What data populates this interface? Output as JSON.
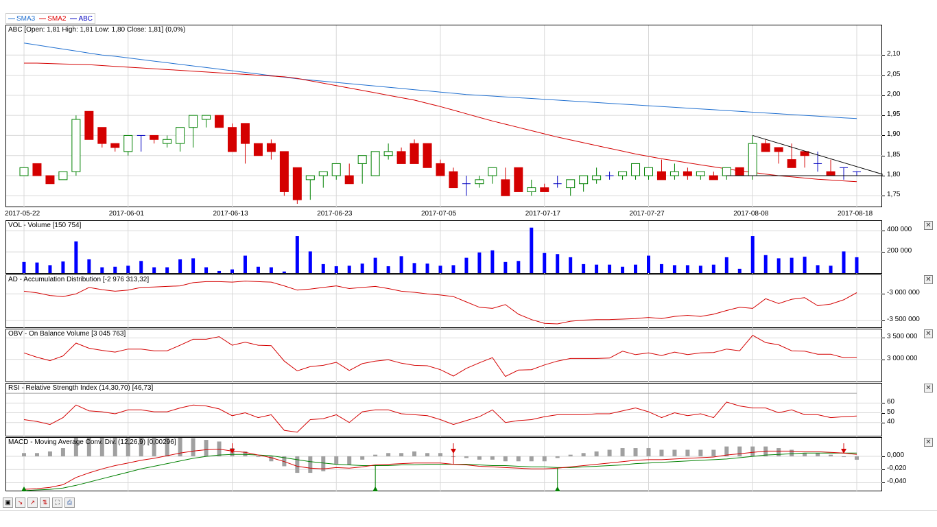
{
  "legend": [
    {
      "label": "SMA3",
      "color": "#1f6fd0"
    },
    {
      "label": "SMA2",
      "color": "#e00000"
    },
    {
      "label": "ABC",
      "color": "#0000c0"
    }
  ],
  "main": {
    "title": "ABC [Open: 1,81  High: 1,81  Low: 1,80  Close: 1,81] (0,0%)",
    "y_ticks": [
      "2,10",
      "2,05",
      "2,00",
      "1,95",
      "1,90",
      "1,85",
      "1,80",
      "1,75"
    ],
    "x_ticks": [
      "2017-05-22",
      "2017-06-01",
      "2017-06-13",
      "2017-06-23",
      "2017-07-05",
      "2017-07-17",
      "2017-07-27",
      "2017-08-08",
      "2017-08-18"
    ]
  },
  "vol": {
    "title": "VOL - Volume [150 754]",
    "y_ticks": [
      "400 000",
      "200 000"
    ]
  },
  "ad": {
    "title": "AD - Accumulation Distribution [-2 976 313,32]",
    "y_ticks": [
      "-3 000 000",
      "-3 500 000"
    ]
  },
  "obv": {
    "title": "OBV - On Balance Volume [3 045 763]",
    "y_ticks": [
      "3 500 000",
      "3 000 000"
    ]
  },
  "rsi": {
    "title": "RSI - Relative Strength Index (14,30,70) [46,73]",
    "y_ticks": [
      "60",
      "50",
      "40"
    ]
  },
  "macd": {
    "title": "MACD - Moving Average Conv. Div. (12,26,9) [0,00296]",
    "y_ticks": [
      "0,000",
      "-0,020",
      "-0,040"
    ]
  },
  "colors": {
    "up": "#008000",
    "down": "#d40000",
    "doji": "#0000c0",
    "volume": "#0000ff",
    "line": "#d40000",
    "signal": "#008000",
    "hist": "#a0a0a0",
    "grid": "#d8d8d8"
  },
  "chart_data": {
    "type": "candlestick",
    "dates": [
      "2017-05-22",
      "2017-05-23",
      "2017-05-24",
      "2017-05-25",
      "2017-05-26",
      "2017-05-29",
      "2017-05-30",
      "2017-05-31",
      "2017-06-01",
      "2017-06-02",
      "2017-06-05",
      "2017-06-06",
      "2017-06-07",
      "2017-06-08",
      "2017-06-09",
      "2017-06-12",
      "2017-06-13",
      "2017-06-14",
      "2017-06-15",
      "2017-06-16",
      "2017-06-19",
      "2017-06-20",
      "2017-06-21",
      "2017-06-22",
      "2017-06-23",
      "2017-06-26",
      "2017-06-27",
      "2017-06-28",
      "2017-06-29",
      "2017-06-30",
      "2017-07-03",
      "2017-07-04",
      "2017-07-05",
      "2017-07-06",
      "2017-07-07",
      "2017-07-10",
      "2017-07-11",
      "2017-07-12",
      "2017-07-13",
      "2017-07-14",
      "2017-07-17",
      "2017-07-18",
      "2017-07-19",
      "2017-07-20",
      "2017-07-21",
      "2017-07-24",
      "2017-07-25",
      "2017-07-26",
      "2017-07-27",
      "2017-07-28",
      "2017-07-31",
      "2017-08-01",
      "2017-08-02",
      "2017-08-03",
      "2017-08-04",
      "2017-08-07",
      "2017-08-08",
      "2017-08-09",
      "2017-08-10",
      "2017-08-11",
      "2017-08-14",
      "2017-08-15",
      "2017-08-16",
      "2017-08-17",
      "2017-08-18"
    ],
    "open": [
      1.8,
      1.83,
      1.8,
      1.79,
      1.81,
      1.96,
      1.92,
      1.88,
      1.86,
      1.9,
      1.9,
      1.88,
      1.88,
      1.92,
      1.94,
      1.95,
      1.92,
      1.93,
      1.88,
      1.88,
      1.86,
      1.82,
      1.79,
      1.8,
      1.8,
      1.8,
      1.83,
      1.8,
      1.85,
      1.86,
      1.88,
      1.88,
      1.83,
      1.81,
      1.78,
      1.78,
      1.8,
      1.79,
      1.82,
      1.76,
      1.77,
      1.78,
      1.77,
      1.78,
      1.79,
      1.8,
      1.8,
      1.8,
      1.8,
      1.81,
      1.8,
      1.81,
      1.8,
      1.8,
      1.8,
      1.82,
      1.8,
      1.88,
      1.87,
      1.84,
      1.86,
      1.83,
      1.81,
      1.82,
      1.81
    ],
    "high": [
      1.82,
      1.83,
      1.8,
      1.81,
      1.95,
      1.96,
      1.92,
      1.88,
      1.86,
      1.9,
      1.9,
      1.9,
      1.91,
      1.92,
      1.95,
      1.95,
      1.93,
      1.93,
      1.88,
      1.89,
      1.86,
      1.82,
      1.79,
      1.81,
      1.82,
      1.83,
      1.83,
      1.84,
      1.88,
      1.87,
      1.89,
      1.88,
      1.84,
      1.82,
      1.8,
      1.8,
      1.82,
      1.82,
      1.82,
      1.79,
      1.78,
      1.8,
      1.79,
      1.8,
      1.82,
      1.81,
      1.81,
      1.81,
      1.82,
      1.84,
      1.83,
      1.82,
      1.81,
      1.81,
      1.82,
      1.82,
      1.9,
      1.89,
      1.87,
      1.88,
      1.86,
      1.86,
      1.84,
      1.82,
      1.81
    ],
    "low": [
      1.8,
      1.8,
      1.78,
      1.79,
      1.8,
      1.89,
      1.87,
      1.86,
      1.85,
      1.86,
      1.88,
      1.87,
      1.86,
      1.87,
      1.92,
      1.92,
      1.88,
      1.83,
      1.85,
      1.84,
      1.75,
      1.73,
      1.74,
      1.77,
      1.79,
      1.78,
      1.78,
      1.8,
      1.84,
      1.85,
      1.83,
      1.84,
      1.8,
      1.79,
      1.75,
      1.77,
      1.78,
      1.79,
      1.79,
      1.75,
      1.76,
      1.77,
      1.75,
      1.76,
      1.78,
      1.79,
      1.79,
      1.79,
      1.79,
      1.8,
      1.79,
      1.79,
      1.79,
      1.79,
      1.79,
      1.8,
      1.79,
      1.86,
      1.83,
      1.83,
      1.82,
      1.81,
      1.8,
      1.79,
      1.8
    ],
    "close": [
      1.82,
      1.8,
      1.78,
      1.81,
      1.94,
      1.89,
      1.88,
      1.87,
      1.9,
      1.9,
      1.89,
      1.89,
      1.92,
      1.95,
      1.95,
      1.92,
      1.86,
      1.88,
      1.85,
      1.86,
      1.76,
      1.74,
      1.8,
      1.81,
      1.83,
      1.78,
      1.85,
      1.86,
      1.86,
      1.83,
      1.83,
      1.82,
      1.8,
      1.77,
      1.78,
      1.79,
      1.82,
      1.75,
      1.76,
      1.77,
      1.76,
      1.78,
      1.79,
      1.8,
      1.8,
      1.8,
      1.81,
      1.83,
      1.82,
      1.79,
      1.81,
      1.8,
      1.81,
      1.79,
      1.82,
      1.8,
      1.88,
      1.86,
      1.86,
      1.82,
      1.85,
      1.83,
      1.8,
      1.82,
      1.81
    ],
    "sma3": [
      2.13,
      2.125,
      2.12,
      2.115,
      2.11,
      2.105,
      2.1,
      2.097,
      2.093,
      2.089,
      2.085,
      2.081,
      2.077,
      2.073,
      2.069,
      2.065,
      2.061,
      2.057,
      2.053,
      2.049,
      2.045,
      2.041,
      2.038,
      2.035,
      2.032,
      2.029,
      2.026,
      2.023,
      2.02,
      2.017,
      2.014,
      2.011,
      2.008,
      2.005,
      2.002,
      2.0,
      1.998,
      1.996,
      1.994,
      1.992,
      1.99,
      1.988,
      1.986,
      1.984,
      1.982,
      1.98,
      1.978,
      1.976,
      1.974,
      1.972,
      1.97,
      1.968,
      1.966,
      1.964,
      1.962,
      1.96,
      1.958,
      1.956,
      1.954,
      1.952,
      1.95,
      1.948,
      1.946,
      1.944,
      1.942
    ],
    "sma2": [
      2.08,
      2.08,
      2.079,
      2.078,
      2.077,
      2.076,
      2.074,
      2.072,
      2.07,
      2.068,
      2.066,
      2.064,
      2.062,
      2.06,
      2.058,
      2.056,
      2.054,
      2.052,
      2.05,
      2.048,
      2.046,
      2.042,
      2.036,
      2.03,
      2.024,
      2.018,
      2.012,
      2.006,
      2.0,
      1.994,
      1.988,
      1.98,
      1.972,
      1.963,
      1.954,
      1.945,
      1.936,
      1.928,
      1.92,
      1.912,
      1.904,
      1.896,
      1.889,
      1.882,
      1.875,
      1.868,
      1.861,
      1.854,
      1.848,
      1.842,
      1.837,
      1.832,
      1.827,
      1.822,
      1.817,
      1.812,
      1.808,
      1.804,
      1.8,
      1.797,
      1.794,
      1.791,
      1.789,
      1.787,
      1.785
    ],
    "volume": [
      105000,
      100000,
      75000,
      110000,
      300000,
      130000,
      55000,
      60000,
      70000,
      115000,
      55000,
      55000,
      130000,
      140000,
      55000,
      20000,
      35000,
      165000,
      60000,
      55000,
      15000,
      350000,
      205000,
      85000,
      65000,
      70000,
      90000,
      145000,
      65000,
      160000,
      95000,
      90000,
      70000,
      75000,
      145000,
      195000,
      215000,
      105000,
      115000,
      430000,
      190000,
      180000,
      150000,
      85000,
      80000,
      80000,
      60000,
      80000,
      165000,
      85000,
      75000,
      75000,
      70000,
      80000,
      150000,
      40000,
      350000,
      170000,
      140000,
      145000,
      155000,
      75000,
      70000,
      205000,
      150000
    ],
    "ad": [
      -2950000,
      -2980000,
      -3030000,
      -3050000,
      -3000000,
      -2880000,
      -2920000,
      -2950000,
      -2930000,
      -2880000,
      -2870000,
      -2860000,
      -2850000,
      -2790000,
      -2770000,
      -2770000,
      -2780000,
      -2760000,
      -2770000,
      -2780000,
      -2850000,
      -2930000,
      -2910000,
      -2880000,
      -2850000,
      -2900000,
      -2880000,
      -2860000,
      -2900000,
      -2950000,
      -2970000,
      -3000000,
      -3020000,
      -3050000,
      -3150000,
      -3250000,
      -3270000,
      -3200000,
      -3380000,
      -3480000,
      -3550000,
      -3560000,
      -3510000,
      -3490000,
      -3480000,
      -3480000,
      -3470000,
      -3460000,
      -3440000,
      -3460000,
      -3420000,
      -3400000,
      -3420000,
      -3380000,
      -3310000,
      -3250000,
      -3270000,
      -3090000,
      -3180000,
      -3100000,
      -3070000,
      -3220000,
      -3190000,
      -3110000,
      -2976313
    ],
    "obv": [
      3150000,
      3050000,
      2970000,
      3080000,
      3380000,
      3260000,
      3210000,
      3170000,
      3240000,
      3240000,
      3200000,
      3200000,
      3330000,
      3470000,
      3470000,
      3530000,
      3330000,
      3400000,
      3330000,
      3320000,
      2960000,
      2730000,
      2830000,
      2860000,
      2930000,
      2740000,
      2900000,
      2960000,
      2990000,
      2910000,
      2860000,
      2850000,
      2760000,
      2610000,
      2790000,
      2920000,
      3040000,
      2600000,
      2750000,
      2760000,
      2870000,
      2960000,
      3020000,
      3020000,
      3020000,
      3030000,
      3190000,
      3110000,
      3150000,
      3090000,
      3170000,
      3110000,
      3150000,
      3160000,
      3240000,
      3200000,
      3560000,
      3390000,
      3340000,
      3200000,
      3190000,
      3120000,
      3120000,
      3040000,
      3045763
    ],
    "rsi": [
      43,
      41,
      38,
      45,
      58,
      52,
      51,
      49,
      53,
      53,
      51,
      51,
      55,
      58,
      57,
      54,
      47,
      50,
      45,
      48,
      32,
      30,
      43,
      44,
      48,
      40,
      51,
      53,
      53,
      49,
      48,
      47,
      43,
      38,
      42,
      46,
      53,
      40,
      42,
      43,
      46,
      48,
      48,
      48,
      49,
      49,
      52,
      55,
      51,
      45,
      50,
      47,
      49,
      45,
      61,
      57,
      55,
      55,
      50,
      53,
      48,
      48,
      45,
      46,
      46.73
    ],
    "macd": [
      -0.05,
      -0.049,
      -0.047,
      -0.043,
      -0.032,
      -0.025,
      -0.019,
      -0.014,
      -0.01,
      -0.006,
      -0.003,
      0.001,
      0.005,
      0.008,
      0.01,
      0.011,
      0.008,
      0.006,
      0.002,
      -0.002,
      -0.008,
      -0.015,
      -0.018,
      -0.019,
      -0.017,
      -0.018,
      -0.016,
      -0.013,
      -0.012,
      -0.011,
      -0.01,
      -0.01,
      -0.01,
      -0.012,
      -0.013,
      -0.015,
      -0.016,
      -0.017,
      -0.018,
      -0.019,
      -0.019,
      -0.018,
      -0.016,
      -0.014,
      -0.012,
      -0.01,
      -0.008,
      -0.006,
      -0.005,
      -0.005,
      -0.004,
      -0.003,
      -0.002,
      -0.001,
      0.002,
      0.004,
      0.006,
      0.008,
      0.008,
      0.008,
      0.007,
      0.007,
      0.006,
      0.005,
      0.00296
    ],
    "macd_signal": [
      -0.052,
      -0.051,
      -0.05,
      -0.048,
      -0.044,
      -0.039,
      -0.034,
      -0.029,
      -0.024,
      -0.019,
      -0.015,
      -0.011,
      -0.007,
      -0.003,
      0.0,
      0.002,
      0.003,
      0.003,
      0.002,
      0.001,
      -0.002,
      -0.005,
      -0.008,
      -0.01,
      -0.012,
      -0.013,
      -0.014,
      -0.014,
      -0.014,
      -0.013,
      -0.013,
      -0.012,
      -0.012,
      -0.012,
      -0.012,
      -0.013,
      -0.014,
      -0.014,
      -0.015,
      -0.016,
      -0.016,
      -0.017,
      -0.017,
      -0.016,
      -0.015,
      -0.014,
      -0.013,
      -0.011,
      -0.01,
      -0.009,
      -0.008,
      -0.007,
      -0.006,
      -0.005,
      -0.004,
      -0.002,
      0.0,
      0.002,
      0.003,
      0.004,
      0.005,
      0.005,
      0.005,
      0.005,
      0.005
    ],
    "trend_line": {
      "from": [
        "2017-08-08",
        1.9
      ],
      "to": [
        "2017-08-18",
        1.81
      ]
    },
    "support_line": {
      "from": [
        "2017-08-04",
        1.8
      ],
      "to": [
        "2017-08-18",
        1.8
      ]
    },
    "macd_buy_signals": [
      "2017-05-22",
      "2017-06-28",
      "2017-07-18"
    ],
    "macd_sell_signals": [
      "2017-06-13",
      "2017-07-06",
      "2017-08-17"
    ],
    "ylim": [
      1.73,
      2.15
    ]
  },
  "toolbar": [
    "save-icon",
    "indicator-down-icon",
    "indicator-up-icon",
    "indicator-both-icon",
    "fit-icon",
    "print-icon"
  ]
}
